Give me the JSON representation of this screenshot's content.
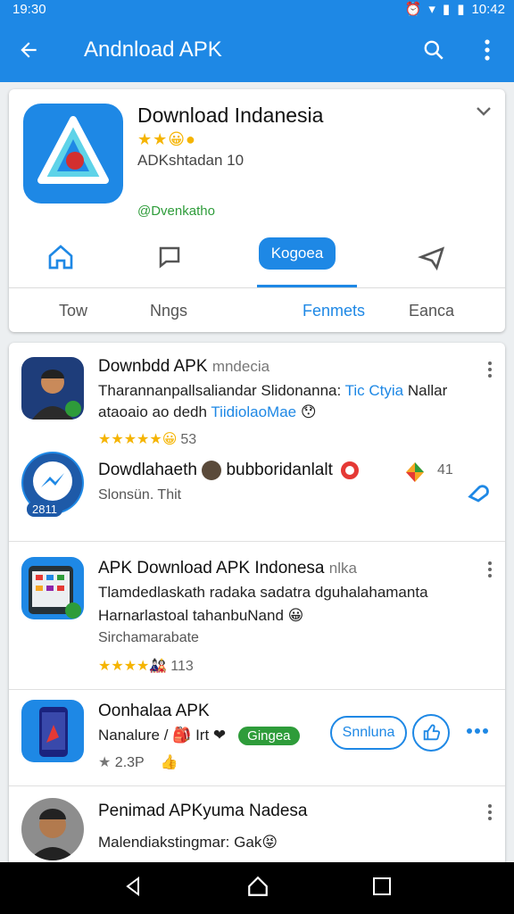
{
  "status_bar": {
    "time": "19:30",
    "right_time": "10:42"
  },
  "app_bar": {
    "title": "Andnload APK"
  },
  "app_card": {
    "name": "Download Indanesia",
    "rating_stars": "★★😀●",
    "subline": "ADKshtadan 10",
    "developer": "@Dvenkatho",
    "pill_label": "Kogoea",
    "tabs": [
      "Tow",
      "Nngs",
      "Fenmets",
      "Eanca"
    ],
    "active_tab": "Fenmets"
  },
  "list": {
    "items": [
      {
        "title": "Downbdd APK",
        "title_muted": "mndecia",
        "line1": "Tharannanpallsaliandar Slidonanna:",
        "line1_link": "Tic Ctyia",
        "line1_end": "Nallar",
        "line2": "ataoaio ao dedh",
        "line2_link": "TiidiolaoMae",
        "line2_emoji": "😯",
        "stars": "★★★★★😀",
        "count": "53"
      },
      {
        "title": "Dowdlahaeth",
        "title_rest": "bubboridanlalt",
        "subtitle": "Slonsün. Thit",
        "badge": "2811",
        "count": "41"
      },
      {
        "title": "APK Download APK Indonesa",
        "title_muted": "nlka",
        "line1": "Tlamdedlaskath radaka sadatra dguhalahamanta",
        "line2": "Harnarlastoal tahanbuNand",
        "line2_emoji": "😀",
        "line3": "Sirchamarabate",
        "stars": "★★★★🎎",
        "count": "113"
      },
      {
        "title": "Oonhalaa APK",
        "line1": "Nanalure",
        "line1_mid": "/ 🎒 Irt ❤",
        "pill": "Gingea",
        "button": "Snnluna",
        "rating": "2.3P"
      },
      {
        "title": "Penimad APKyuma Nadesa",
        "line1": "Malendiakstingmar:",
        "line1_end": "Gak😝"
      }
    ]
  },
  "colors": {
    "primary": "#1e88e5",
    "green": "#2e9c3a",
    "star": "#f5b400"
  }
}
